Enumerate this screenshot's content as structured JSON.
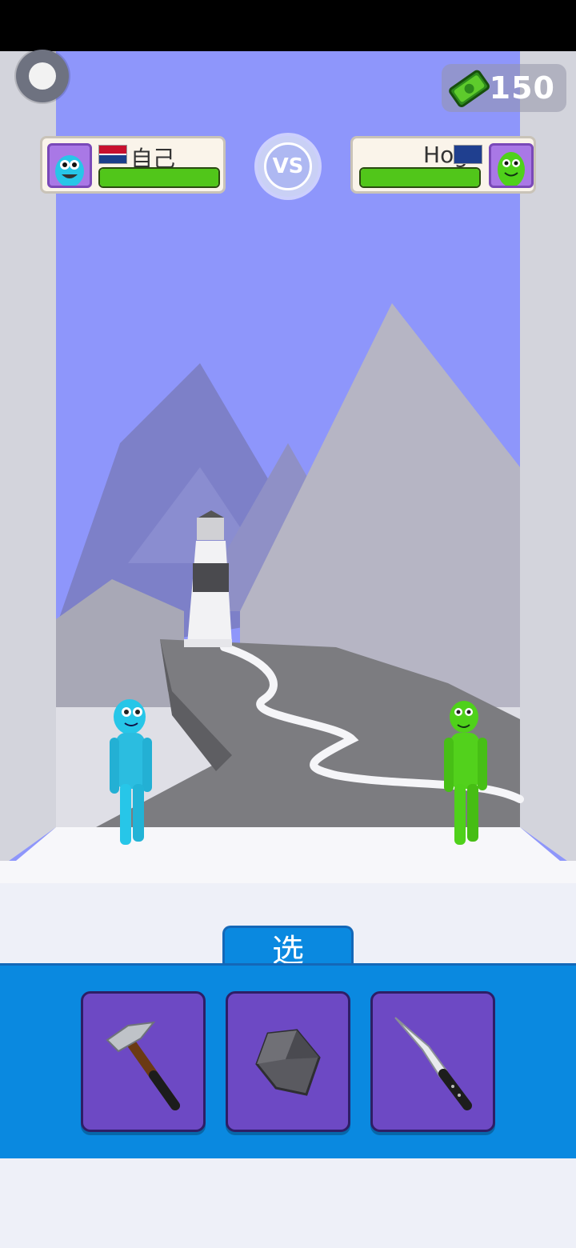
{
  "hud": {
    "currency_amount": "150",
    "currency_icon": "cash-icon",
    "settings_icon": "settings-icon",
    "vs_label": "VS"
  },
  "player": {
    "name": "自己",
    "avatar_color": "#27c6e8",
    "health_fraction": 1.0
  },
  "opponent": {
    "name": "Hog",
    "avatar_color": "#4fd11a",
    "health_fraction": 1.0
  },
  "weapon_panel": {
    "title": "选",
    "weapons": [
      {
        "icon": "hammer-icon"
      },
      {
        "icon": "rock-icon"
      },
      {
        "icon": "knife-icon"
      }
    ]
  },
  "colors": {
    "sky": "#8e96fb",
    "panel_blue": "#0a89e0",
    "slot_purple": "#6d49c4",
    "health_green": "#51c61a"
  }
}
